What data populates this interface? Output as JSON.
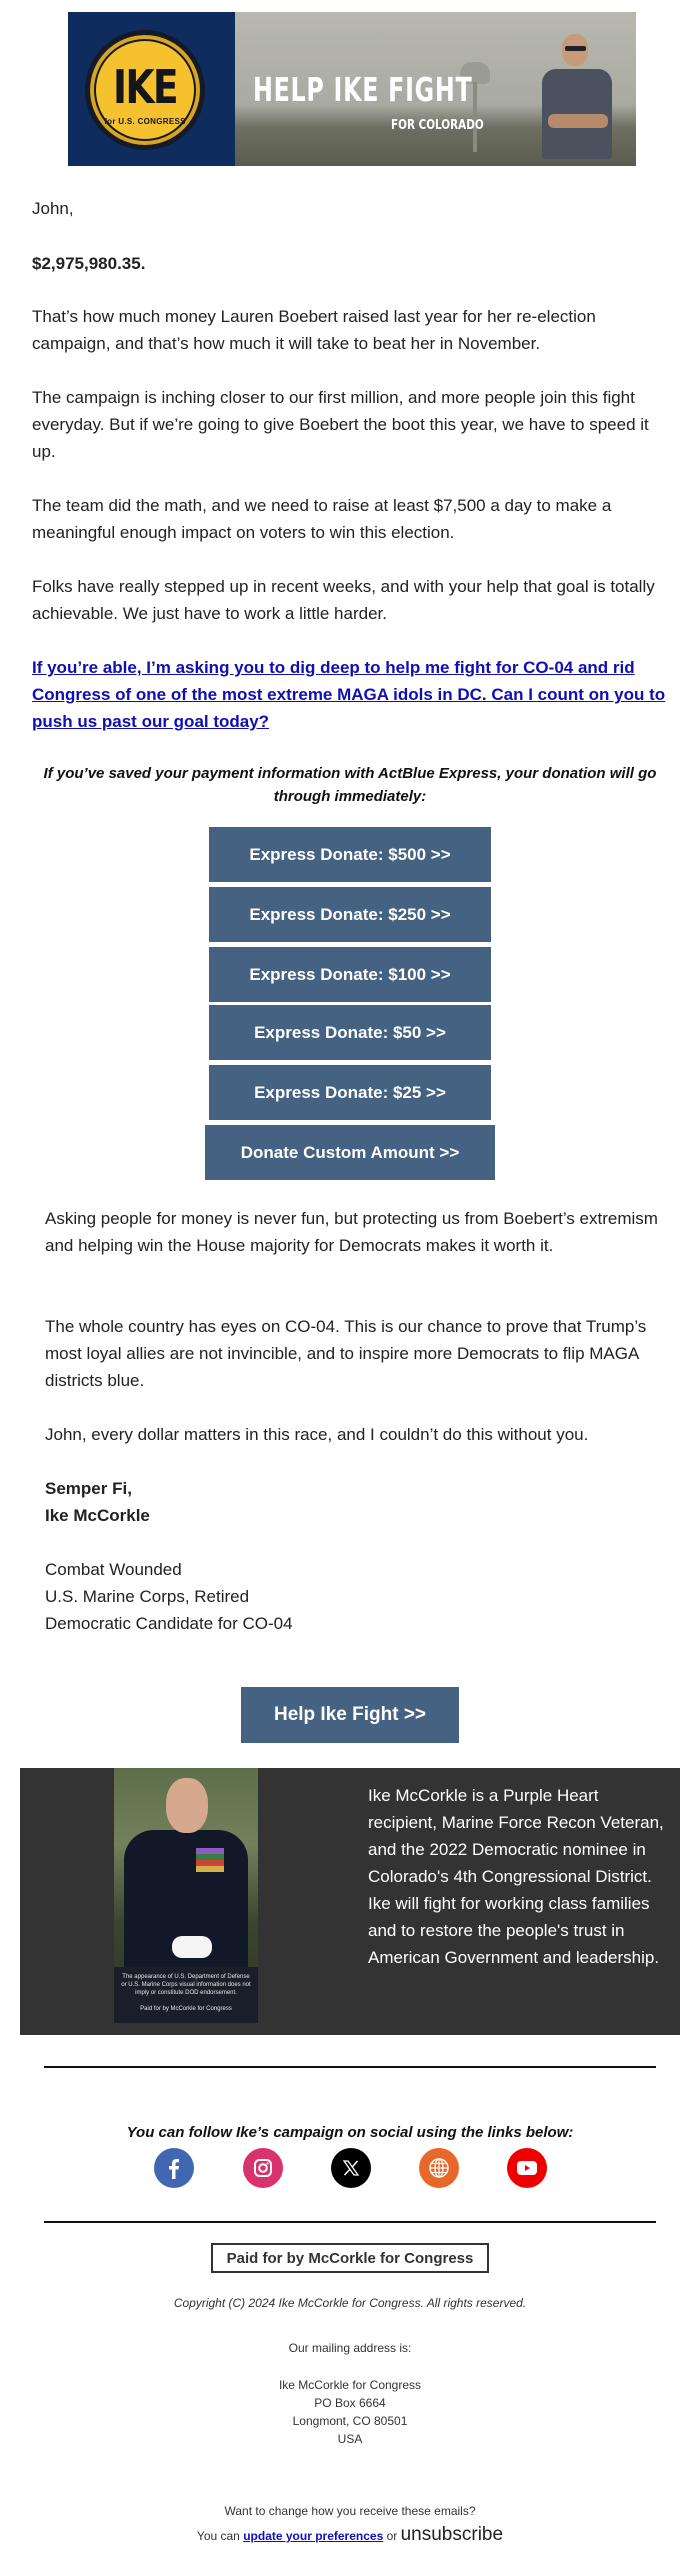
{
  "banner": {
    "logo_text": "IKE",
    "logo_subtext": "for U.S. CONGRESS",
    "headline": "HELP IKE FIGHT",
    "subheadline": "FOR COLORADO"
  },
  "body": {
    "greeting": "John,",
    "amount": "$2,975,980.35.",
    "paragraphs": [
      "That’s how much money Lauren Boebert raised last year for her re-election campaign, and that’s how much it will take to beat her in November.",
      "The campaign is inching closer to our first million, and more people join this fight everyday. But if we’re going to give Boebert the boot this year, we have to speed it up.",
      "The team did the math, and we need to raise at least $7,500 a day to make a meaningful enough impact on voters to win this election.",
      "Folks have really stepped up in recent weeks, and with your help that goal is totally achievable. We just have to work a little harder."
    ],
    "cta_link": "If you’re able, I’m asking you to dig deep to help me fight for CO-04 and rid Congress of one of the most extreme MAGA idols in DC. Can I count on you to push us past our goal today?",
    "express_note": "If you’ve saved your payment information with ActBlue Express, your donation will go through immediately:"
  },
  "donate_buttons": [
    {
      "label": "Express Donate: $500 >>",
      "amount": 500
    },
    {
      "label": "Express Donate: $250 >>",
      "amount": 250
    },
    {
      "label": "Express Donate: $100 >>",
      "amount": 100
    },
    {
      "label": "Express Donate: $50 >>",
      "amount": 50
    },
    {
      "label": "Express Donate: $25 >>",
      "amount": 25
    }
  ],
  "custom_donate_label": "Donate Custom Amount >>",
  "closing": {
    "paragraphs": [
      "Asking people for money is never fun, but protecting us from Boebert’s extremism and helping win the House majority for Democrats makes it worth it.",
      "The whole country has eyes on CO-04. This is our chance to prove that Trump’s most loyal allies are not invincible, and to inspire more Democrats to flip MAGA districts blue.",
      "John, every dollar matters in this race, and I couldn’t do this without you."
    ],
    "signoff": "Semper Fi,",
    "signer": "Ike McCorkle",
    "titles": [
      "Combat Wounded",
      "U.S. Marine Corps, Retired",
      "Democratic Candidate for CO-04"
    ]
  },
  "help_button_label": "Help Ike Fight >>",
  "bio": {
    "text": "Ike McCorkle is a Purple Heart recipient, Marine Force Recon Veteran, and the 2022 Democratic nominee in Colorado's 4th Congressional District. Ike will fight for working class families and to restore the people's trust in American Government and leadership.",
    "photo_disclaimer": "The appearance of U.S. Department of Defense or U.S. Marine Corps visual information does not imply or constitute DOD endorsement.",
    "photo_paid_for": "Paid for by McCorkle for Congress"
  },
  "social": {
    "title": "You can follow Ike’s campaign on social using the links below:",
    "links": [
      {
        "name": "facebook",
        "icon": "facebook-icon",
        "color": "#4267b2"
      },
      {
        "name": "instagram",
        "icon": "instagram-icon",
        "color": "#d8336c"
      },
      {
        "name": "x",
        "icon": "x-icon",
        "color": "#000000"
      },
      {
        "name": "website",
        "icon": "globe-icon",
        "color": "#e8672a"
      },
      {
        "name": "youtube",
        "icon": "youtube-icon",
        "color": "#ee0000"
      }
    ]
  },
  "footer": {
    "paid_for": "Paid for by McCorkle for Congress",
    "copyright": "Copyright (C) 2024 Ike McCorkle for Congress. All rights reserved.",
    "mailing_label": "Our mailing address is:",
    "address": [
      "Ike McCorkle for Congress",
      "PO Box 6664",
      "Longmont, CO 80501",
      "USA"
    ],
    "change_prompt": "Want to change how you receive these emails?",
    "you_can": "You can",
    "update_prefs": "update your preferences",
    "or": "or",
    "unsubscribe": "unsubscribe"
  },
  "colors": {
    "button": "#466282",
    "link": "#1010c0",
    "bio_background": "#333333"
  }
}
